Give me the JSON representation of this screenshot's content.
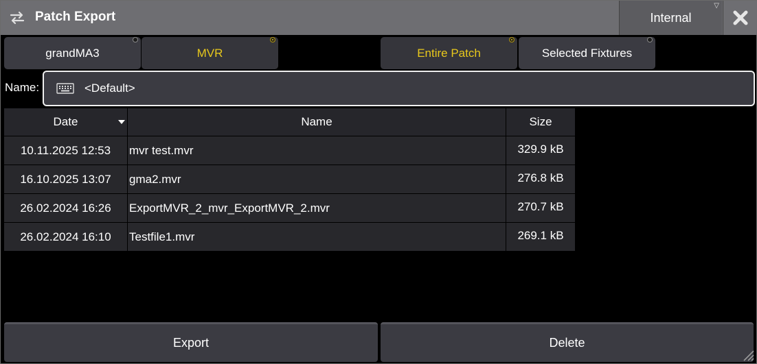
{
  "window": {
    "title": "Patch Export",
    "destination": "Internal",
    "title_icon": "swap-arrows-icon",
    "close_icon": "close-icon"
  },
  "format_options": [
    {
      "label": "grandMA3",
      "active": false
    },
    {
      "label": "MVR",
      "active": true
    }
  ],
  "scope_options": [
    {
      "label": "Entire Patch",
      "active": true
    },
    {
      "label": "Selected Fixtures",
      "active": false
    }
  ],
  "name_field": {
    "label": "Name:",
    "value": "<Default>",
    "icon": "keyboard-icon"
  },
  "table": {
    "headers": {
      "date": "Date",
      "name": "Name",
      "size": "Size"
    },
    "sort_column": "Date",
    "rows": [
      {
        "date": "10.11.2025 12:53",
        "name": "mvr test.mvr",
        "size": "329.9 kB"
      },
      {
        "date": "16.10.2025 13:07",
        "name": "gma2.mvr",
        "size": "276.8 kB"
      },
      {
        "date": "26.02.2024 16:26",
        "name": "ExportMVR_2_mvr_ExportMVR_2.mvr",
        "size": "270.7 kB"
      },
      {
        "date": "26.02.2024 16:10",
        "name": "Testfile1.mvr",
        "size": "269.1 kB"
      }
    ]
  },
  "actions": {
    "export_label": "Export",
    "delete_label": "Delete"
  },
  "colors": {
    "accent": "#e8c81c",
    "titlebar": "#6e6e72",
    "button": "#3b3b42",
    "background": "#000000"
  }
}
